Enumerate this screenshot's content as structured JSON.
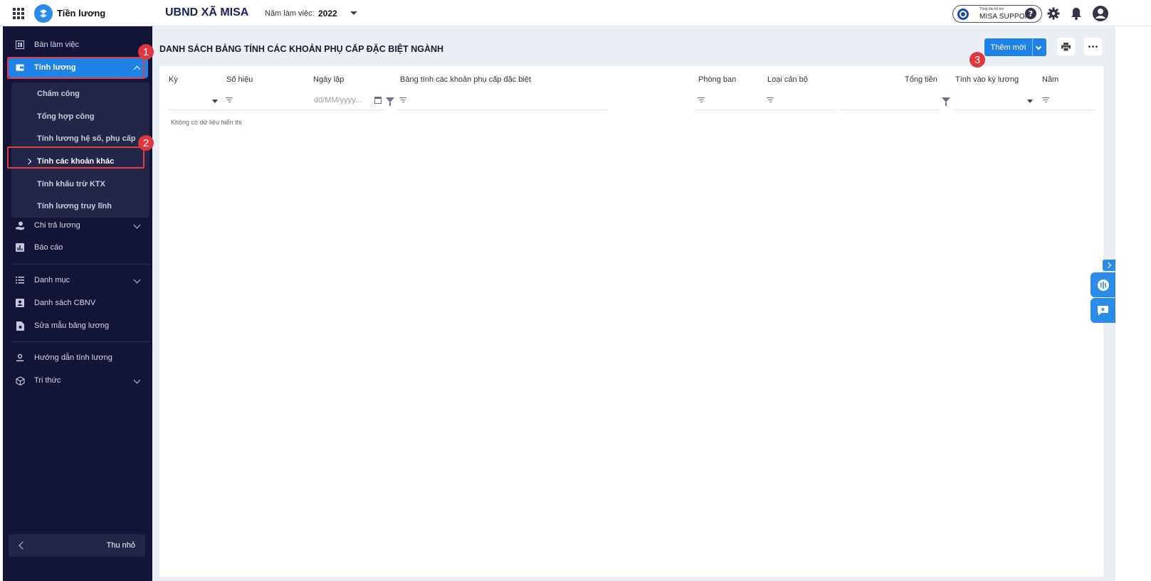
{
  "topbar": {
    "app_name": "Tiền lương",
    "org_name": "UBND XÃ MISA",
    "year_label": "Năm làm việc:",
    "year_value": "2022",
    "support_small": "Tổng đài hỗ trợ",
    "support_big": "MISA SUPPORT"
  },
  "sidebar": {
    "items": [
      {
        "label": "Bàn làm việc",
        "icon": "dashboard-icon"
      },
      {
        "label": "Tính lương",
        "icon": "wallet-icon"
      },
      {
        "label": "Chi trả lương",
        "icon": "hand-coin-icon"
      },
      {
        "label": "Báo cáo",
        "icon": "report-chart-icon"
      },
      {
        "label": "Danh mục",
        "icon": "list-icon"
      },
      {
        "label": "Danh sách CBNV",
        "icon": "contact-card-icon"
      },
      {
        "label": "Sửa mẫu bảng lương",
        "icon": "document-edit-icon"
      },
      {
        "label": "Hướng dẫn tính lương",
        "icon": "user-guide-icon"
      },
      {
        "label": "Tri thức",
        "icon": "cube-icon"
      }
    ],
    "submenu": [
      "Chấm công",
      "Tổng hợp công",
      "Tính lương hệ số, phụ cấp",
      "Tính các khoản khác",
      "Tính khấu trừ KTX",
      "Tính lương truy lĩnh"
    ],
    "collapse_label": "Thu nhỏ"
  },
  "badges": [
    "1",
    "2",
    "3"
  ],
  "main": {
    "title": "DANH SÁCH BẢNG TÍNH CÁC KHOẢN PHỤ CẤP ĐẶC BIỆT NGÀNH",
    "add_button": "Thêm mới",
    "columns": [
      "Kỳ",
      "Số hiệu",
      "Ngày lập",
      "Bảng tính các khoản phụ cấp đặc biệt",
      "Phòng ban",
      "Loại cán bộ",
      "Tổng tiền",
      "Tính vào kỳ lương",
      "Năm"
    ],
    "date_placeholder": "dd/MM/yyyy...",
    "empty_text": "Không có dữ liệu hiển thị"
  },
  "colors": {
    "sidebar_bg": "#121537",
    "accent": "#1e82e6",
    "highlight": "#e23d45",
    "main_bg": "#eceef6"
  }
}
